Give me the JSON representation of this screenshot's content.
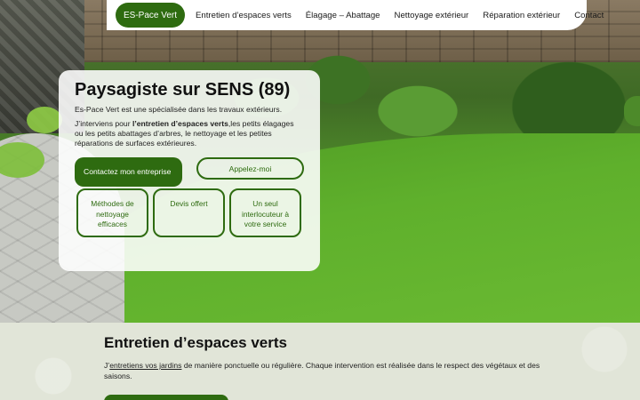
{
  "nav": {
    "brand": "ES-Pace Vert",
    "items": [
      "Entretien d’espaces verts",
      "Élagage – Abattage",
      "Nettoyage extérieur",
      "Réparation extérieur",
      "Contact"
    ]
  },
  "hero": {
    "title": "Paysagiste sur SENS (89)",
    "intro": "Es-Pace Vert est une spécialisée dans les travaux extérieurs.",
    "body_prefix": "J’interviens pour ",
    "body_bold": "l’entretien d’espaces verts",
    "body_suffix": ",les petits élagages ou les petits abattages d’arbres, le nettoyage et les petites réparations de surfaces extérieures.",
    "contact_button": "Contactez mon entreprise",
    "call_button": "Appelez-moi",
    "features": [
      "Méthodes de nettoyage efficaces",
      "Devis offert",
      "Un seul interlocuteur à votre service"
    ]
  },
  "section": {
    "title": "Entretien d’espaces verts",
    "desc_prefix": "J’",
    "desc_link": "entretiens vos jardins",
    "desc_suffix": " de manière ponctuelle ou régulière. Chaque intervention est réalisée dans le respect des végétaux et des saisons."
  },
  "colors": {
    "brand_green": "#2e6b10",
    "section_bg": "#e1e5d8"
  }
}
